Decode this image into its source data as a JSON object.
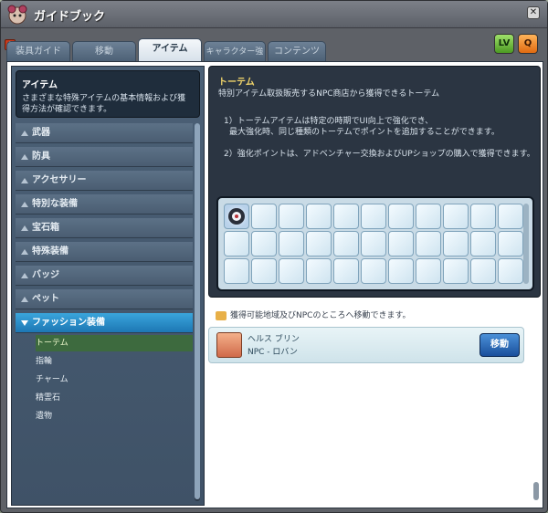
{
  "window": {
    "title": "ガイドブック",
    "close_label": "✕"
  },
  "tabs": [
    {
      "label": "装具ガイド"
    },
    {
      "label": "移動"
    },
    {
      "label": "アイテム"
    },
    {
      "label": "キャラクター強化"
    },
    {
      "label": "コンテンツ"
    }
  ],
  "toolbar": {
    "lv_label": "LV",
    "search_label": "Q"
  },
  "sidebar": {
    "header_title": "アイテム",
    "header_desc": "さまざまな特殊アイテムの基本情報および獲得方法が確認できます。",
    "categories": [
      {
        "label": "武器"
      },
      {
        "label": "防具"
      },
      {
        "label": "アクセサリー"
      },
      {
        "label": "特別な装備"
      },
      {
        "label": "宝石箱"
      },
      {
        "label": "特殊装備"
      },
      {
        "label": "バッジ"
      },
      {
        "label": "ペット"
      },
      {
        "label": "ファッション装備"
      }
    ],
    "subitems": [
      {
        "label": "トーテム"
      },
      {
        "label": "指輪"
      },
      {
        "label": "チャーム"
      },
      {
        "label": "精霊石"
      },
      {
        "label": "遺物"
      }
    ]
  },
  "info": {
    "title": "トーテム",
    "line1": "特別アイテム取扱販売するNPC商店から獲得できるトーテム",
    "line2": "1）トーテムアイテムは特定の時期でUI向上で強化でき、",
    "line3": "最大強化時、同じ種類のトーテムでポイントを追加することができます。",
    "line4": "2）強化ポイントは、アドベンチャー交換およびUPショップの購入で獲得できます。"
  },
  "npc": {
    "section_label": "獲得可能地域及びNPCのところへ移動できます。",
    "name": "ヘルス ブリン",
    "subtitle": "NPC - ロバン",
    "move_label": "移動"
  }
}
